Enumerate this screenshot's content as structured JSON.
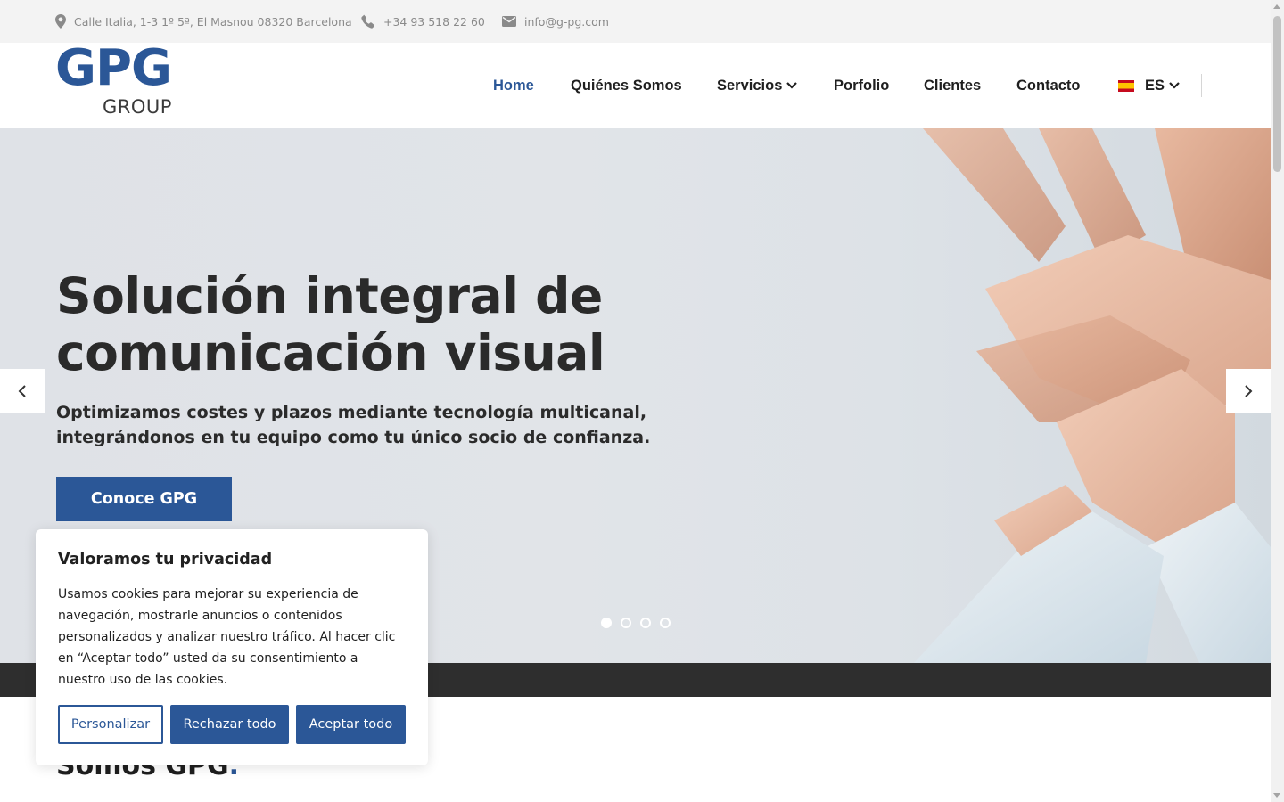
{
  "topbar": {
    "address": "Calle Italia, 1-3 1º 5ª, El Masnou 08320 Barcelona",
    "address_icon": "map-pin-icon",
    "phone": "+34 93 518 22 60",
    "phone_icon": "phone-icon",
    "email": "info@g-pg.com",
    "email_icon": "envelope-icon"
  },
  "logo": {
    "main": "GPG",
    "sub": "GROUP"
  },
  "nav": {
    "home": "Home",
    "about": "Quiénes Somos",
    "services": "Servicios",
    "portfolio": "Porfolio",
    "clients": "Clientes",
    "contact": "Contacto",
    "language": "ES"
  },
  "hero": {
    "title_line1": "Solución integral de",
    "title_line2": "comunicación visual",
    "subtitle_line1": "Optimizamos costes y plazos mediante tecnología multicanal,",
    "subtitle_line2": "integrándonos en tu equipo como tu único socio de confianza.",
    "cta": "Conoce GPG",
    "slides_total": 4,
    "active_slide": 1
  },
  "section": {
    "title": "Somos GPG",
    "accent": "."
  },
  "cookie": {
    "title": "Valoramos tu privacidad",
    "text": "Usamos cookies para mejorar su experiencia de navegación, mostrarle anuncios o contenidos personalizados y analizar nuestro tráfico. Al hacer clic en “Aceptar todo” usted da su consentimiento a nuestro uso de las cookies.",
    "customize": "Personalizar",
    "reject": "Rechazar todo",
    "accept": "Aceptar todo"
  },
  "colors": {
    "brand": "#2b5797",
    "dark_band": "#2e2e2e",
    "topbar_bg": "#f3f3f3"
  }
}
